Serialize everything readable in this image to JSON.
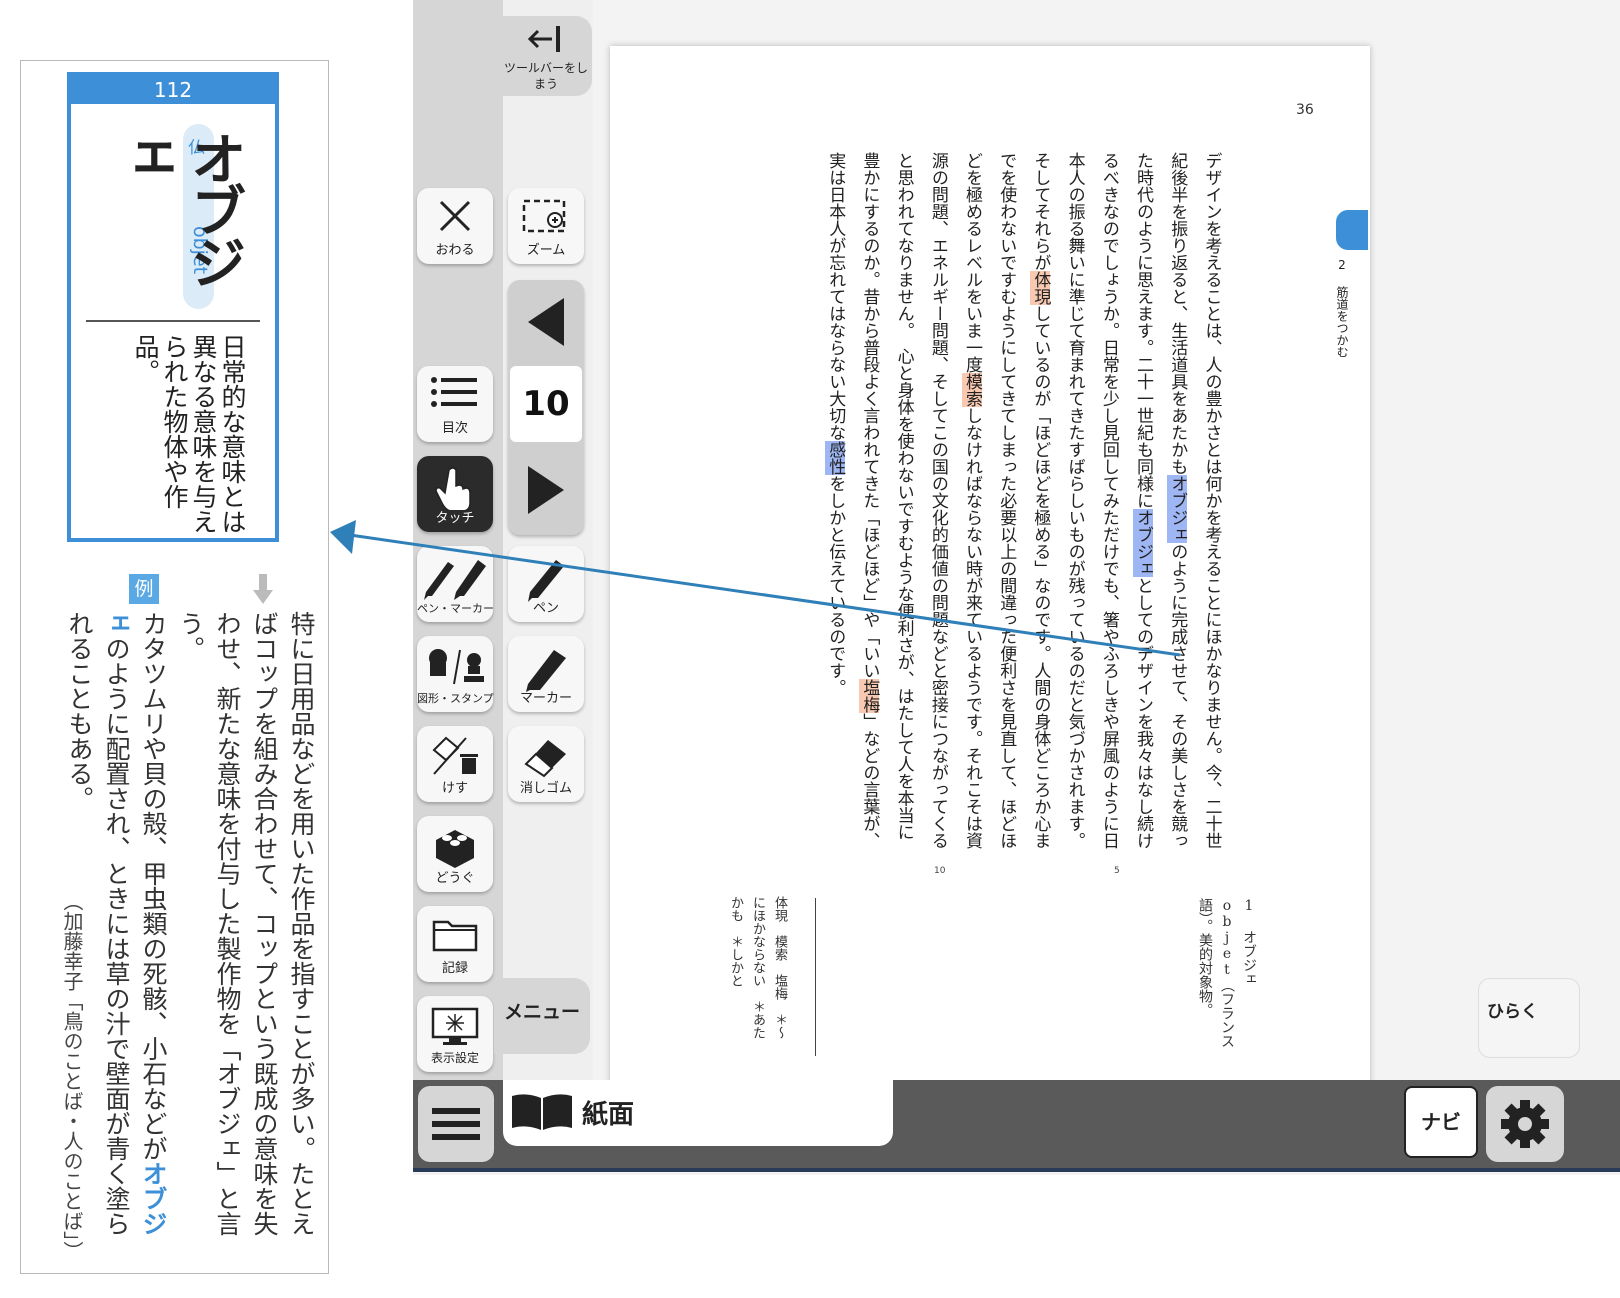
{
  "dictionary": {
    "page_number": "112",
    "headword": "オブジェ",
    "category_label": "仏",
    "origin_word": "objet",
    "definition": "日常的な意味とは異なる意味を与えられた物体や作品。",
    "example_badge": "例",
    "example_text_1": "特に日用品などを用いた作品を指すことが多い。たとえばコップを組み合わせて、コップという既成の意味を失わせ、新たな意味を付与した製作物を「オブジェ」と言う。",
    "example_text_2a": "カタツムリや貝の殻、甲虫類の死骸、小石などが",
    "example_text_2b": "オブジェ",
    "example_text_2c": "のように配置され、ときには草の汁で壁面が青く塗られることもある。",
    "example_source": "（加藤幸子「鳥のことば・人のことば」）"
  },
  "toolbar": {
    "hide_label": "ツールバーをしまう",
    "end_label": "おわる",
    "zoom_label": "ズーム",
    "toc_label": "目次",
    "touch_label": "タッチ",
    "pen_marker_label": "ペン・マーカー",
    "pen_label": "ペン",
    "shape_stamp_label": "図形・スタンプ",
    "marker_label": "マーカー",
    "erase_label": "けす",
    "eraser_label": "消しゴム",
    "tools_label": "どうぐ",
    "record_label": "記録",
    "display_label": "表示設定",
    "menu_label": "メニュー",
    "page_number": "10"
  },
  "page": {
    "number": "36",
    "chapter": "2 筋道をつかむ",
    "text_a": "デザインを考えることは、人の豊かさとは何かを考えることにほかなりません。今、二十世紀後半を振り返ると、生活道具をあたかも",
    "text_hl1": "オブジェ",
    "text_b": "のように完成させて、その美しさを競った時代のように思えます。二十一世紀も同様に",
    "text_hl2": "オブジェ",
    "text_c": "としてのデザインを我々はなし続けるべきなのでしょうか。日常を少し見回してみただけでも、箸やふろしきや屏風のように日本人の振る舞いに準じて育まれてきたすばらしいものが残っているのだと気づかされます。そしてそれらが",
    "text_hl3": "体現",
    "text_d": "しているのが「ほどほどを極める」なのです。人間の身体どころか心までを使わないですむようにしてきてしまった必要以上の間違った便利さを見直して、ほどほどを極めるレベルをいま一度",
    "text_hl4": "模索",
    "text_e": "しなければならない時が来ているようです。それこそは資源の問題、エネルギー問題、そしてこの国の文化的価値の問題などと密接につながってくると思われてなりません。　心と身体を使わないですむような便利さが、はたして人を本当に豊かにするのか。昔から普段よく言われてきた「ほどほど」や「いい",
    "text_hl5": "塩梅",
    "text_f": "」などの言葉が、実は日本人が忘れてはならない大切な",
    "text_hl6": "感性",
    "text_g": "をしかと伝えているのです。",
    "line_5": "5",
    "line_10": "10",
    "note_1": "1 オブジェ　objet（フランス語）。美的対象物。",
    "note_list": "体現　模索　塩梅　＊～にほかならない　＊あたかも　＊しかと",
    "open_label": "ひらく"
  },
  "bottom_bar": {
    "view_label": "紙面",
    "navi_label": "ナビ"
  },
  "colors": {
    "accent": "#3d8fd8",
    "highlight_blue": "#9fb6f5",
    "highlight_orange": "#f8c9b0",
    "toolbar_gray": "#d6d6d6"
  }
}
